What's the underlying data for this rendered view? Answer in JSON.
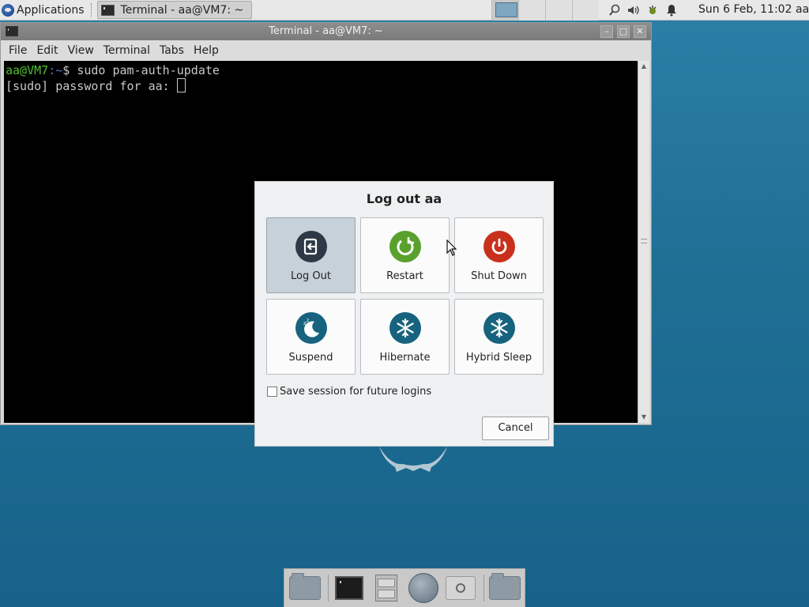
{
  "top_panel": {
    "applications_label": "Applications",
    "task_button_label": "Terminal - aa@VM7: ~",
    "clock": "Sun  6 Feb, 11:02",
    "user": "aa"
  },
  "terminal": {
    "title": "Terminal - aa@VM7: ~",
    "menu": [
      "File",
      "Edit",
      "View",
      "Terminal",
      "Tabs",
      "Help"
    ],
    "prompt_user": "aa@VM7",
    "prompt_path": ":~",
    "prompt_symbol": "$ ",
    "command": "sudo pam-auth-update",
    "sudo_prompt": "[sudo] password for aa: "
  },
  "logout_dialog": {
    "title": "Log out aa",
    "actions": [
      {
        "label": "Log Out",
        "icon": "logout-icon",
        "color": "#2d3a45",
        "selected": true
      },
      {
        "label": "Restart",
        "icon": "restart-icon",
        "color": "#5aa02c",
        "selected": false
      },
      {
        "label": "Shut Down",
        "icon": "power-icon",
        "color": "#c9301c",
        "selected": false
      },
      {
        "label": "Suspend",
        "icon": "moon-icon",
        "color": "#17637f",
        "selected": false
      },
      {
        "label": "Hibernate",
        "icon": "snowflake-icon",
        "color": "#17637f",
        "selected": false
      },
      {
        "label": "Hybrid Sleep",
        "icon": "snowflake-icon",
        "color": "#17637f",
        "selected": false
      }
    ],
    "save_session_label": "Save session for future logins",
    "save_session_checked": false,
    "cancel_label": "Cancel"
  }
}
